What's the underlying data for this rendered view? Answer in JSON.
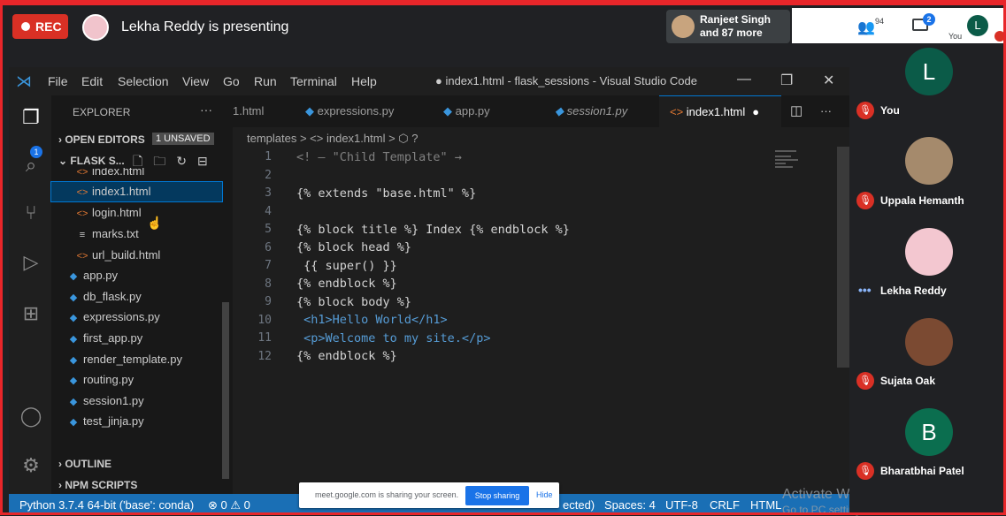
{
  "meet": {
    "rec_label": "REC",
    "presenter_text": "Lekha Reddy is presenting",
    "chip_name": "Ranjeet Singh",
    "chip_more": "and 87 more",
    "people_count": "94",
    "chat_badge": "2",
    "you_initial": "L",
    "you_label": "You",
    "share_text": "meet.google.com is sharing your screen.",
    "share_stop": "Stop sharing",
    "share_hide": "Hide"
  },
  "vscode": {
    "menu": [
      "File",
      "Edit",
      "Selection",
      "View",
      "Go",
      "Run",
      "Terminal",
      "Help"
    ],
    "window_title": "● index1.html - flask_sessions - Visual Studio Code",
    "activity_badge": "1",
    "explorer_title": "EXPLORER",
    "open_editors": "OPEN EDITORS",
    "unsaved": "1 UNSAVED",
    "folder": "FLASK S...",
    "files": [
      {
        "name": "index.html",
        "type": "html"
      },
      {
        "name": "index1.html",
        "type": "html"
      },
      {
        "name": "login.html",
        "type": "html"
      },
      {
        "name": "marks.txt",
        "type": "txt"
      },
      {
        "name": "url_build.html",
        "type": "html"
      },
      {
        "name": "app.py",
        "type": "py"
      },
      {
        "name": "db_flask.py",
        "type": "py"
      },
      {
        "name": "expressions.py",
        "type": "py"
      },
      {
        "name": "first_app.py",
        "type": "py"
      },
      {
        "name": "render_template.py",
        "type": "py"
      },
      {
        "name": "routing.py",
        "type": "py"
      },
      {
        "name": "session1.py",
        "type": "py"
      },
      {
        "name": "test_jinja.py",
        "type": "py"
      }
    ],
    "outline": "OUTLINE",
    "npm_scripts": "NPM SCRIPTS",
    "tabs": [
      "1.html",
      "expressions.py",
      "app.py",
      "session1.py",
      "index1.html"
    ],
    "breadcrumb": "templates  >  <> index1.html  >  ⬡ ?",
    "line_numbers": [
      "1",
      "2",
      "3",
      "4",
      "5",
      "6",
      "7",
      "8",
      "9",
      "10",
      "11",
      "12"
    ],
    "code_lines": [
      "<! — \"Child Template\" →",
      "",
      "{% extends \"base.html\" %}",
      "",
      "{% block title %} Index {% endblock %}",
      "{% block head %}",
      " {{ super() }}",
      "{% endblock %}",
      "{% block body %}",
      " <h1>Hello World</h1>",
      " <p>Welcome to my site.</p>",
      "{% endblock %}"
    ],
    "status_python": "Python 3.7.4 64-bit ('base': conda)",
    "status_problems": "⊗ 0 ⚠ 0",
    "status_spaces": "Spaces: 4",
    "status_encoding": "UTF-8",
    "status_eol": "CRLF",
    "status_lang": "HTML",
    "status_partial": "ected)"
  },
  "activate": {
    "line1": "Activate Windows",
    "line2": "Go to PC settings to activate Windows."
  },
  "participants": [
    {
      "name": "You",
      "initial": "L",
      "color": "#0b5b48"
    },
    {
      "name": "Uppala Hemanth",
      "initial": "",
      "color": "#a58a6c"
    },
    {
      "name": "Lekha Reddy",
      "initial": "",
      "color": "#f3c7d0"
    },
    {
      "name": "Sujata Oak",
      "initial": "",
      "color": "#7b4a32"
    },
    {
      "name": "Bharatbhai Patel",
      "initial": "B",
      "color": "#0b6e4f"
    }
  ],
  "colors": {
    "rec": "#d93025",
    "vscode_blue": "#1a6fb5",
    "accent": "#1a73e8"
  }
}
